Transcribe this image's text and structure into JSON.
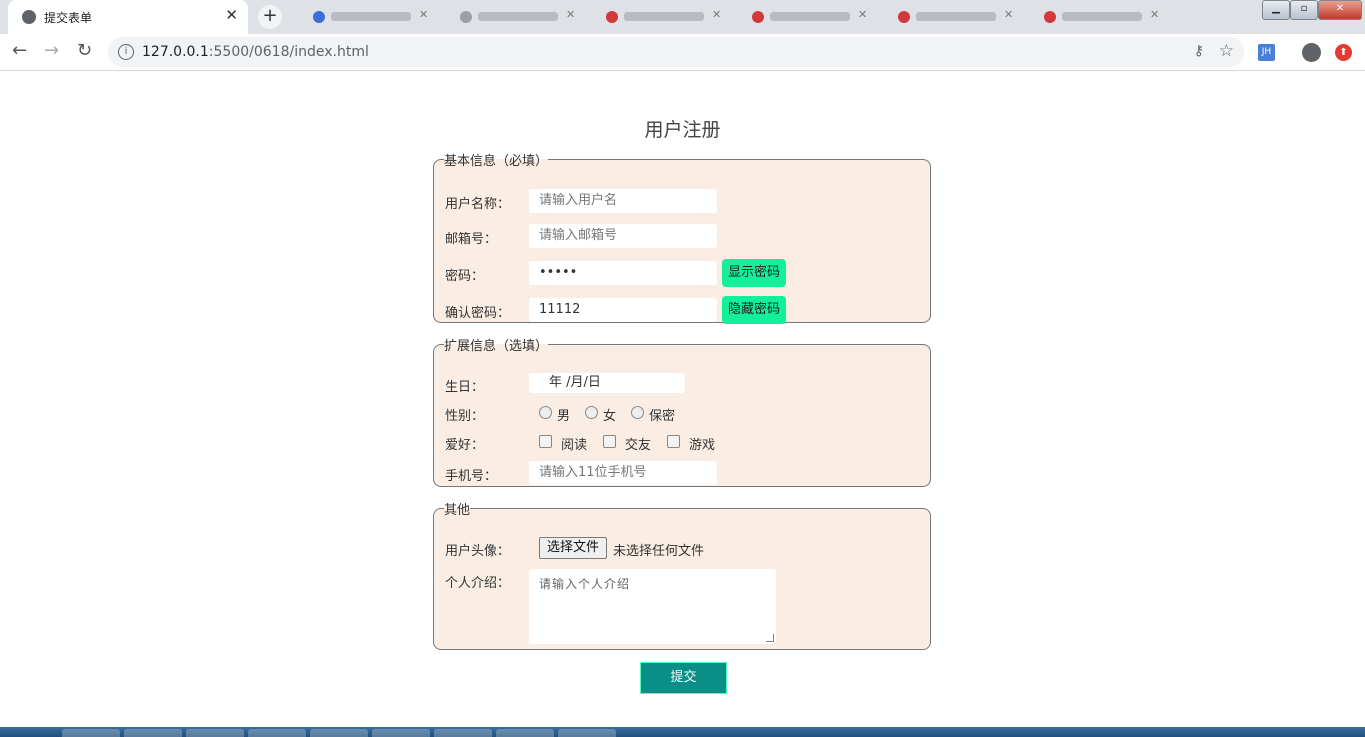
{
  "browser": {
    "active_tab_title": "提交表单",
    "new_tab_label": "+",
    "tab_close": "✕",
    "url_host": "127.0.0.1",
    "url_path": ":5500/0618/index.html",
    "ext_label": "JH",
    "background_tab_colors": [
      "#3b6fd8",
      "#9aa0a6",
      "#d03a3a",
      "#d03a3a",
      "#d03a3a",
      "#d03a3a"
    ]
  },
  "form": {
    "title": "用户注册",
    "basic": {
      "legend": "基本信息（必填）",
      "username_label": "用户名称：",
      "username_placeholder": "请输入用户名",
      "email_label": "邮箱号：",
      "email_placeholder": "请输入邮箱号",
      "password_label": "密码：",
      "password_value": "•••••",
      "show_password_button": "显示密码",
      "confirm_label": "确认密码：",
      "confirm_value": "11112",
      "hide_password_button": "隐藏密码"
    },
    "extended": {
      "legend": "扩展信息（选填）",
      "birthday_label": "生日：",
      "birthday_placeholder": "年 /月/日",
      "gender_label": "性别：",
      "gender_options": [
        "男",
        "女",
        "保密"
      ],
      "hobby_label": "爱好：",
      "hobby_options": [
        "阅读",
        "交友",
        "游戏"
      ],
      "phone_label": "手机号：",
      "phone_placeholder": "请输入11位手机号"
    },
    "other": {
      "legend": "其他",
      "avatar_label": "用户头像：",
      "file_button": "选择文件",
      "file_status": "未选择任何文件",
      "intro_label": "个人介绍：",
      "intro_placeholder": "请输入个人介绍"
    },
    "submit_label": "提交"
  }
}
